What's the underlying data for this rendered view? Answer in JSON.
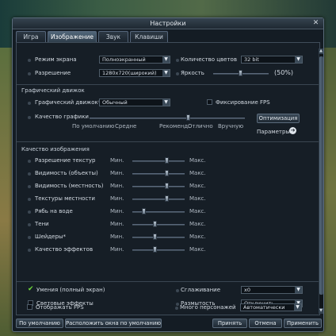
{
  "window": {
    "title": "Настройки",
    "close_glyph": "✕"
  },
  "tabs": [
    {
      "label": "Игра",
      "active": false
    },
    {
      "label": "Изображение",
      "active": true
    },
    {
      "label": "Звук",
      "active": false
    },
    {
      "label": "Клавиши",
      "active": false
    }
  ],
  "screen": {
    "mode_label": "Режим экрана",
    "mode_value": "Полноэкранный",
    "resolution_label": "Разрешение",
    "resolution_value": "1280x720(широкий)",
    "colors_label": "Количество цветов",
    "colors_value": "32 bit",
    "brightness_label": "Яркость",
    "brightness_value": "(50%)",
    "brightness_level": 0.5
  },
  "engine": {
    "section_title": "Графический движок",
    "engine_label": "Графический движок*",
    "engine_value": "Обычный",
    "fps_lock_label": "Фиксирование FPS",
    "quality_label": "Качество графики",
    "scale": [
      "По умолчанию",
      "Средне",
      "Рекоменд.",
      "Отлично",
      "Вручную"
    ],
    "quality_level": 0.64,
    "optimize_button": "Оптимизация",
    "params_label": "Параметры",
    "params_arrow": "➔"
  },
  "image_quality": {
    "section_title": "Качество изображения",
    "min_label": "Мин.",
    "max_label": "Макс.",
    "rows": [
      {
        "label": "Разрешение текстур",
        "level": 0.67
      },
      {
        "label": "Видимость (объекты)",
        "level": 0.67
      },
      {
        "label": "Видимость (местность)",
        "level": 0.67
      },
      {
        "label": "Текстуры местности",
        "level": 0.67
      },
      {
        "label": "Рябь на воде",
        "level": 0.22
      },
      {
        "label": "Тени",
        "level": 0.44
      },
      {
        "label": "Шейдеры*",
        "level": 0.44
      },
      {
        "label": "Качество эффектов",
        "level": 0.44
      }
    ]
  },
  "effects": {
    "skills_label": "Умения (полный экран)",
    "skills_checked": true,
    "light_label": "Световые эффекты",
    "antialias_label": "Сглаживание",
    "antialias_value": "x0",
    "blur_label": "Размытость",
    "blur_value": "Отключить",
    "fps_label": "Отображать FPS",
    "many_chars_label": "Много персонажей",
    "many_chars_value": "Автоматически"
  },
  "footer": {
    "default_button": "По умолчанию",
    "arrange_button": "Расположить окна по умолчанию",
    "accept_button": "Принять",
    "cancel_button": "Отмена",
    "apply_button": "Применить"
  },
  "colors": {
    "accent_check": "#6fdc3a",
    "panel_bg": "#161e26"
  },
  "icons": {
    "dropdown": "chevron-down-icon",
    "scroll_up": "▲",
    "scroll_down": "▼",
    "dropdown_glyph": "▼"
  }
}
